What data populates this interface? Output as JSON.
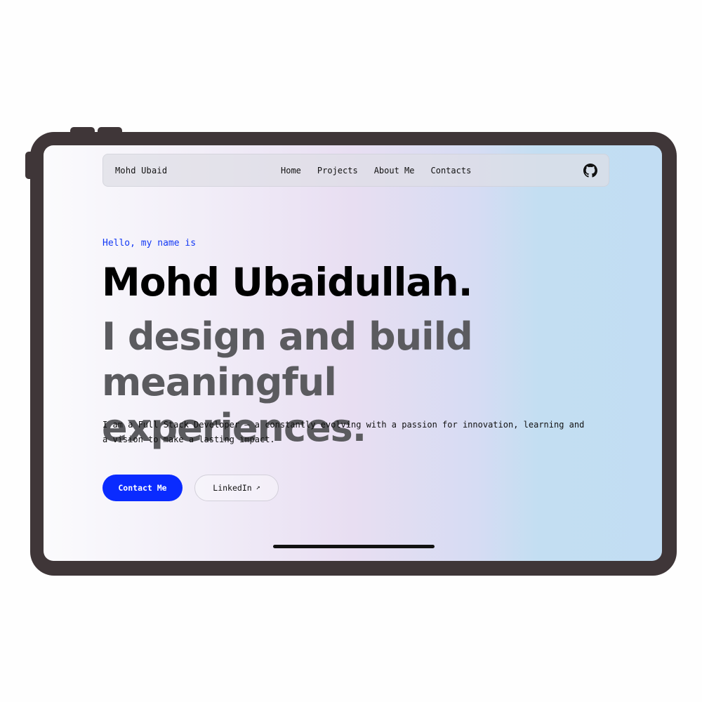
{
  "nav": {
    "brand": "Mohd Ubaid",
    "links": [
      "Home",
      "Projects",
      "About Me",
      "Contacts"
    ],
    "github_icon": "github-icon"
  },
  "hero": {
    "greeting": "Hello, my name is",
    "name": "Mohd Ubaidullah.",
    "tagline": "I design and build meaningful experiences.",
    "bio": "I am a Full Stack Developer — a constantly evolving with a passion for innovation, learning and a vision to make a lasting impact.",
    "primary_button": "Contact Me",
    "secondary_button": "LinkedIn",
    "secondary_icon": "arrow-up-right-icon"
  },
  "colors": {
    "accent": "#0a2bff",
    "greeting": "#1238f5",
    "tagline": "#5b5b5f",
    "device_frame": "#3f3638"
  }
}
